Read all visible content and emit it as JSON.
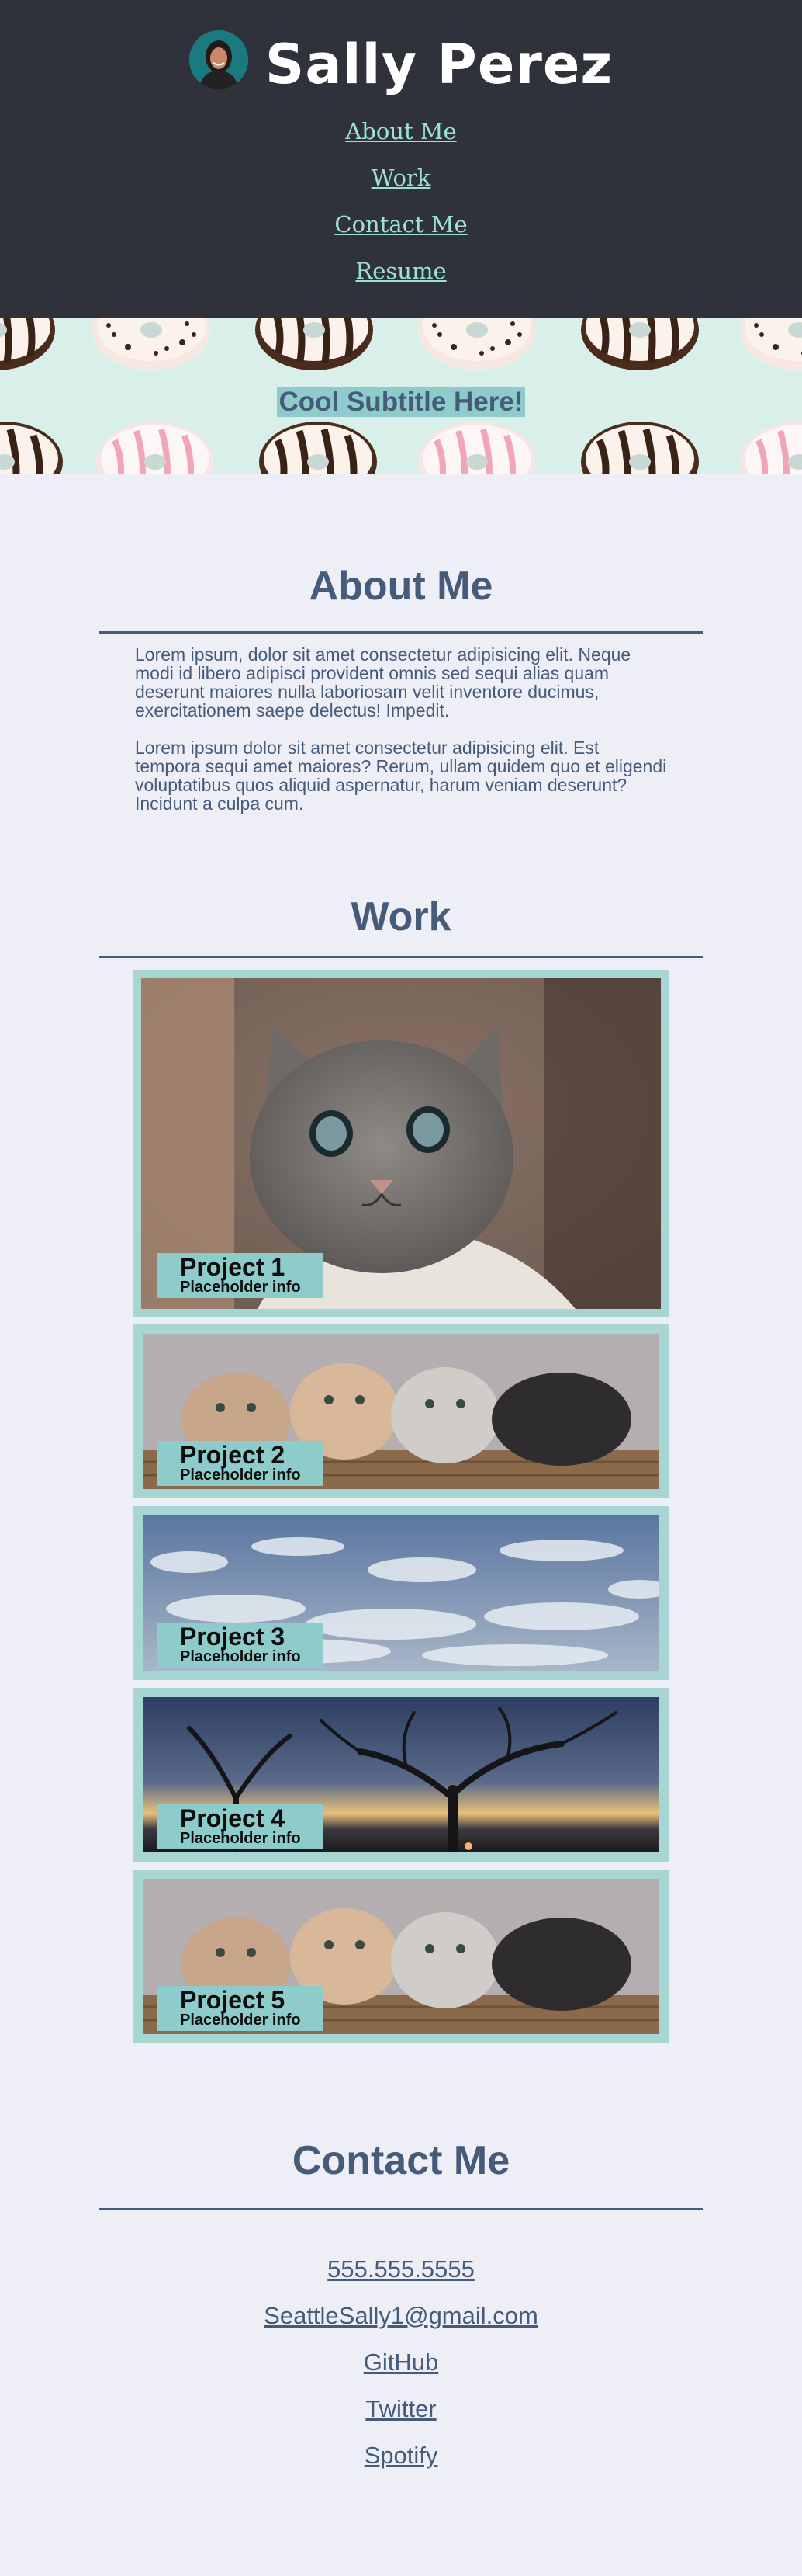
{
  "header": {
    "site_title": "Sally Perez",
    "nav": [
      "About Me",
      "Work",
      "Contact Me",
      "Resume"
    ]
  },
  "hero": {
    "subtitle": "Cool Subtitle Here!"
  },
  "about": {
    "heading": "About Me",
    "paragraphs": [
      "Lorem ipsum, dolor sit amet consectetur adipisicing elit. Neque modi id libero adipisci provident omnis sed sequi alias quam deserunt maiores nulla laboriosam velit inventore ducimus, exercitationem saepe delectus! Impedit.",
      "Lorem ipsum dolor sit amet consectetur adipisicing elit. Est tempora sequi amet maiores? Rerum, ullam quidem quo et eligendi voluptatibus quos aliquid aspernatur, harum veniam deserunt? Incidunt a culpa cum."
    ]
  },
  "work": {
    "heading": "Work",
    "projects": [
      {
        "title": "Project 1",
        "info": "Placeholder info",
        "image": "kitten-photo"
      },
      {
        "title": "Project 2",
        "info": "Placeholder info",
        "image": "kittens-basket-photo"
      },
      {
        "title": "Project 3",
        "info": "Placeholder info",
        "image": "cloudy-sky-photo"
      },
      {
        "title": "Project 4",
        "info": "Placeholder info",
        "image": "tree-sunset-photo"
      },
      {
        "title": "Project 5",
        "info": "Placeholder info",
        "image": "kittens-basket-photo"
      }
    ]
  },
  "contact": {
    "heading": "Contact Me",
    "links": [
      "555.555.5555",
      "SeattleSally1@gmail.com",
      "GitHub",
      "Twitter",
      "Spotify"
    ]
  },
  "colors": {
    "header_bg": "#30323b",
    "nav_link": "#9ce0da",
    "accent": "#455b7a",
    "card_border": "#a6d5d3",
    "label_bg": "#8ecccc",
    "page_bg": "#eeeef6"
  }
}
